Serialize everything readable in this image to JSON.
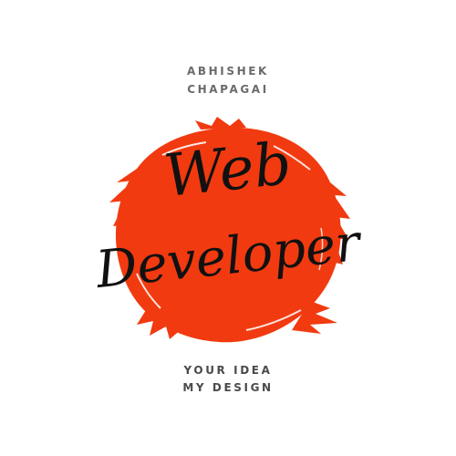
{
  "header": {
    "name_line1": "ABHISHEK",
    "name_line2": "CHAPAGAI"
  },
  "emblem": {
    "title_line1": "Web",
    "title_line2": "Developer",
    "brush_color": "#f23a10",
    "text_color": "#111111"
  },
  "footer": {
    "tagline_line1": "YOUR IDEA",
    "tagline_line2": "MY DESIGN"
  }
}
